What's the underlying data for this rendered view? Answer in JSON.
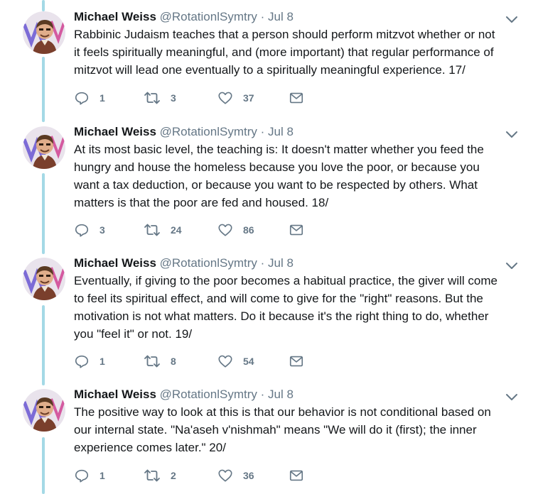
{
  "colors": {
    "thread_line": "#a4d9e6",
    "secondary_text": "#657786",
    "primary_text": "#14171a"
  },
  "icons": {
    "reply": "speech-bubble-icon",
    "retweet": "retweet-arrows-icon",
    "like": "heart-outline-icon",
    "dm": "envelope-icon",
    "caret": "chevron-down-icon"
  },
  "tweets": [
    {
      "name": "Michael Weiss",
      "handle": "@RotationlSymtry",
      "separator": "·",
      "time": "Jul 8",
      "lines": [
        "Rabbinic Judaism teaches that a person should perform mitzvot whether or not",
        "it feels spiritually meaningful, and (more important) that regular performance of",
        "mitzvot will lead one eventually to a spiritually meaningful experience.  17/"
      ],
      "replies": "1",
      "retweets": "3",
      "likes": "37"
    },
    {
      "name": "Michael Weiss",
      "handle": "@RotationlSymtry",
      "separator": "·",
      "time": "Jul 8",
      "lines": [
        "At its most basic level, the teaching is: It doesn't matter whether you feed the",
        "hungry and house the homeless because you love the poor, or because you",
        "want a tax deduction, or because you want to be respected by others. What",
        "matters is that the poor are fed and housed.  18/"
      ],
      "replies": "3",
      "retweets": "24",
      "likes": "86"
    },
    {
      "name": "Michael Weiss",
      "handle": "@RotationlSymtry",
      "separator": "·",
      "time": "Jul 8",
      "lines": [
        "Eventually, if giving to the poor becomes a habitual practice, the giver will come",
        "to feel its spiritual effect, and will come to give for the \"right\" reasons. But the",
        "motivation is not what matters.  Do it because it's the right thing to do, whether",
        "you \"feel it\" or not.  19/"
      ],
      "replies": "1",
      "retweets": "8",
      "likes": "54"
    },
    {
      "name": "Michael Weiss",
      "handle": "@RotationlSymtry",
      "separator": "·",
      "time": "Jul 8",
      "lines": [
        "The positive way to look at this is that our behavior is not conditional based on",
        "our internal state. \"Na'aseh v'nishmah\" means \"We will do it (first); the inner",
        "experience comes later.\"  20/"
      ],
      "replies": "1",
      "retweets": "2",
      "likes": "36"
    }
  ]
}
